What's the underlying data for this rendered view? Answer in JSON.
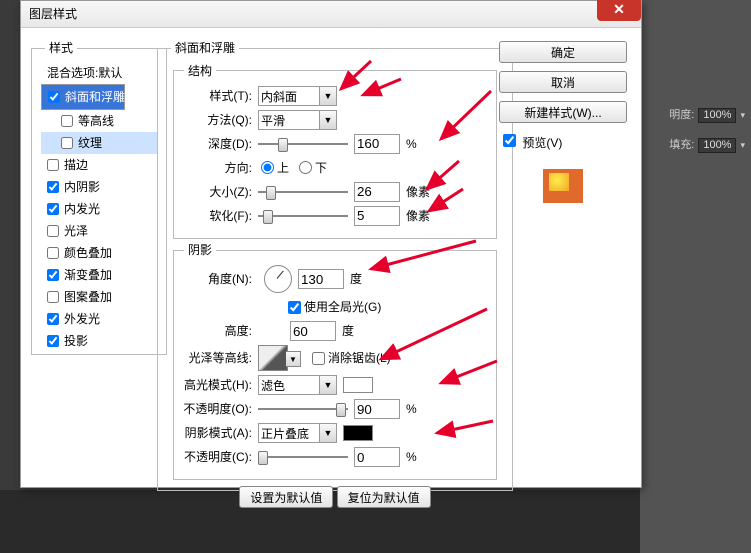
{
  "dialog_title": "图层样式",
  "styles_box_title": "样式",
  "styles_list_header": "混合选项:默认",
  "styles": [
    {
      "label": "斜面和浮雕",
      "checked": true,
      "selected": true
    },
    {
      "label": "等高线",
      "checked": false,
      "sub": true
    },
    {
      "label": "纹理",
      "checked": false,
      "sub": true,
      "hilite": true
    },
    {
      "label": "描边",
      "checked": false
    },
    {
      "label": "内阴影",
      "checked": true
    },
    {
      "label": "内发光",
      "checked": true
    },
    {
      "label": "光泽",
      "checked": false
    },
    {
      "label": "颜色叠加",
      "checked": false
    },
    {
      "label": "渐变叠加",
      "checked": true
    },
    {
      "label": "图案叠加",
      "checked": false
    },
    {
      "label": "外发光",
      "checked": true
    },
    {
      "label": "投影",
      "checked": true
    }
  ],
  "bevel": {
    "group_title": "斜面和浮雕",
    "structure_title": "结构",
    "style_label": "样式(T):",
    "style_value": "内斜面",
    "technique_label": "方法(Q):",
    "technique_value": "平滑",
    "depth_label": "深度(D):",
    "depth_value": "160",
    "depth_unit": "%",
    "direction_label": "方向:",
    "up": "上",
    "down": "下",
    "dir": "up",
    "size_label": "大小(Z):",
    "size_value": "26",
    "size_unit": "像素",
    "soften_label": "软化(F):",
    "soften_value": "5",
    "soften_unit": "像素",
    "shadow_title": "阴影",
    "angle_label": "角度(N):",
    "angle_value": "130",
    "angle_unit": "度",
    "global_light": "使用全局光(G)",
    "global_checked": true,
    "altitude_label": "高度:",
    "altitude_value": "60",
    "altitude_unit": "度",
    "gloss_label": "光泽等高线:",
    "antialias": "消除锯齿(L)",
    "antialias_checked": false,
    "highlight_mode_label": "高光模式(H):",
    "highlight_mode_value": "滤色",
    "highlight_opacity_label": "不透明度(O):",
    "highlight_opacity_value": "90",
    "pct": "%",
    "shadow_mode_label": "阴影模式(A):",
    "shadow_mode_value": "正片叠底",
    "shadow_opacity_label": "不透明度(C):",
    "shadow_opacity_value": "0",
    "make_default": "设置为默认值",
    "reset_default": "复位为默认值"
  },
  "buttons": {
    "ok": "确定",
    "cancel": "取消",
    "new_style": "新建样式(W)...",
    "preview": "预览(V)"
  },
  "bg": {
    "opacity_label": "明度:",
    "opacity_val": "100%",
    "fill_label": "填充:",
    "fill_val": "100%"
  }
}
